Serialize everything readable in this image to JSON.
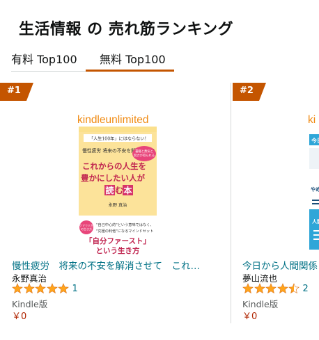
{
  "page": {
    "title": "生活情報 の 売れ筋ランキング",
    "tabs": [
      {
        "label": "有料 Top100",
        "selected": false
      },
      {
        "label": "無料 Top100",
        "selected": true
      }
    ],
    "accent_color": "#c45500",
    "link_color": "#007185",
    "price_color": "#b12704",
    "star_color": "#ffa41c"
  },
  "items": [
    {
      "rank": "#1",
      "cover": {
        "brand": "kindleunlimited",
        "subtitle": "「人生100年」にはならない!",
        "lead": "慢性疲労 将来の不安を解消させて",
        "main_title": "これからの人生を 豊かにしたい人が 読む本",
        "bubble": "書籍と 勇気と 努力が 得られる",
        "author": "永野 真治",
        "note1": "\"自己中心的\"という意味ではなく、",
        "note2": "\"究極の利他\"になるマインドセット",
        "highlight": "「自分ファースト」",
        "tagline": "という生き方",
        "badge": "ケアで 人生の 生き方"
      },
      "title": "慢性疲労　将来の不安を解消させて　これからの人生を豊かにしたい人が読む本",
      "author": "永野真治",
      "rating": 5,
      "review_count": "1",
      "format": "Kindle版",
      "price": "￥0"
    },
    {
      "rank": "#2",
      "cover": {
        "brand": "ki",
        "top": "今日",
        "mid": "やめる方法",
        "side": "人間関係"
      },
      "title": "今日から人間関係",
      "author": "夢山流也",
      "rating": 4.5,
      "review_count": "2",
      "format": "Kindle版",
      "price": "￥0"
    }
  ]
}
